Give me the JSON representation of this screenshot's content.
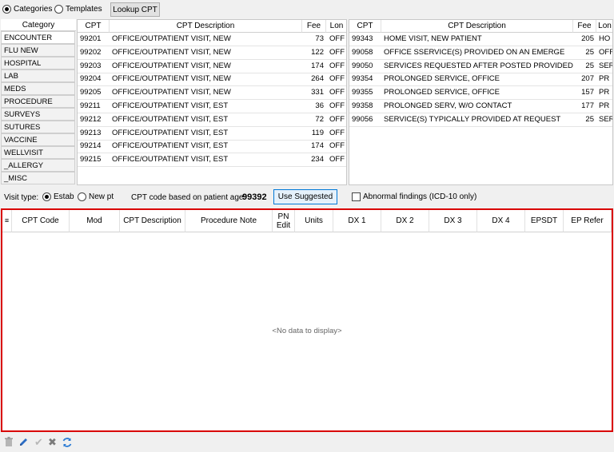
{
  "toolbar": {
    "categories_label": "Categories",
    "templates_label": "Templates",
    "lookup_label": "Lookup CPT",
    "mode_selected": "categories"
  },
  "categories": {
    "header": "Category",
    "selected_index": 0,
    "items": [
      "ENCOUNTER",
      "FLU NEW",
      "HOSPITAL",
      "LAB",
      "MEDS",
      "PROCEDURE",
      "SURVEYS",
      "SUTURES",
      "VACCINE",
      "WELLVISIT",
      "_ALLERGY",
      "_MISC"
    ]
  },
  "cpt_left": {
    "headers": {
      "cpt": "CPT",
      "desc": "CPT Description",
      "fee": "Fee",
      "lon": "Lon"
    },
    "rows": [
      {
        "cpt": "99201",
        "desc": "OFFICE/OUTPATIENT VISIT, NEW",
        "fee": "73",
        "lon": "OFF"
      },
      {
        "cpt": "99202",
        "desc": "OFFICE/OUTPATIENT VISIT, NEW",
        "fee": "122",
        "lon": "OFF"
      },
      {
        "cpt": "99203",
        "desc": "OFFICE/OUTPATIENT VISIT, NEW",
        "fee": "174",
        "lon": "OFF"
      },
      {
        "cpt": "99204",
        "desc": "OFFICE/OUTPATIENT VISIT, NEW",
        "fee": "264",
        "lon": "OFF"
      },
      {
        "cpt": "99205",
        "desc": "OFFICE/OUTPATIENT VISIT, NEW",
        "fee": "331",
        "lon": "OFF"
      },
      {
        "cpt": "99211",
        "desc": "OFFICE/OUTPATIENT VISIT, EST",
        "fee": "36",
        "lon": "OFF"
      },
      {
        "cpt": "99212",
        "desc": "OFFICE/OUTPATIENT VISIT, EST",
        "fee": "72",
        "lon": "OFF"
      },
      {
        "cpt": "99213",
        "desc": "OFFICE/OUTPATIENT VISIT, EST",
        "fee": "119",
        "lon": "OFF"
      },
      {
        "cpt": "99214",
        "desc": "OFFICE/OUTPATIENT VISIT, EST",
        "fee": "174",
        "lon": "OFF"
      },
      {
        "cpt": "99215",
        "desc": "OFFICE/OUTPATIENT VISIT, EST",
        "fee": "234",
        "lon": "OFF"
      }
    ]
  },
  "cpt_right": {
    "headers": {
      "cpt": "CPT",
      "desc": "CPT Description",
      "fee": "Fee",
      "lon": "Lon"
    },
    "rows": [
      {
        "cpt": "99343",
        "desc": "HOME VISIT, NEW PATIENT",
        "fee": "205",
        "lon": "HO"
      },
      {
        "cpt": "99058",
        "desc": "OFFICE SSERVICE(S) PROVIDED ON AN EMERGE",
        "fee": "25",
        "lon": "OFF"
      },
      {
        "cpt": "99050",
        "desc": "SERVICES REQUESTED AFTER POSTED PROVIDED",
        "fee": "25",
        "lon": "SER"
      },
      {
        "cpt": "99354",
        "desc": "PROLONGED SERVICE, OFFICE",
        "fee": "207",
        "lon": "PR"
      },
      {
        "cpt": "99355",
        "desc": "PROLONGED SERVICE, OFFICE",
        "fee": "157",
        "lon": "PR"
      },
      {
        "cpt": "99358",
        "desc": "PROLONGED SERV, W/O CONTACT",
        "fee": "177",
        "lon": "PR"
      },
      {
        "cpt": "99056",
        "desc": "SERVICE(S) TYPICALLY PROVIDED AT REQUEST",
        "fee": "25",
        "lon": "SER"
      }
    ]
  },
  "suggest": {
    "visit_type_label": "Visit type:",
    "estab_label": "Estab",
    "newpt_label": "New pt",
    "visit_selected": "estab",
    "age_label": "CPT code based on patient age:",
    "age_code": "99392",
    "use_suggested_label": "Use Suggested",
    "abnormal_label": "Abnormal findings (ICD-10 only)",
    "abnormal_checked": false
  },
  "selected": {
    "headers": [
      "CPT Code",
      "Mod",
      "CPT Description",
      "Procedure Note",
      "PN Edit",
      "Units",
      "DX 1",
      "DX 2",
      "DX 3",
      "DX 4",
      "EPSDT",
      "EP Refer"
    ],
    "empty_text": "<No data to display>",
    "highlight_color": "#d90000"
  },
  "bottom_icons": [
    "trash-icon",
    "pencil-icon",
    "check-icon",
    "x-icon",
    "refresh-icon"
  ]
}
